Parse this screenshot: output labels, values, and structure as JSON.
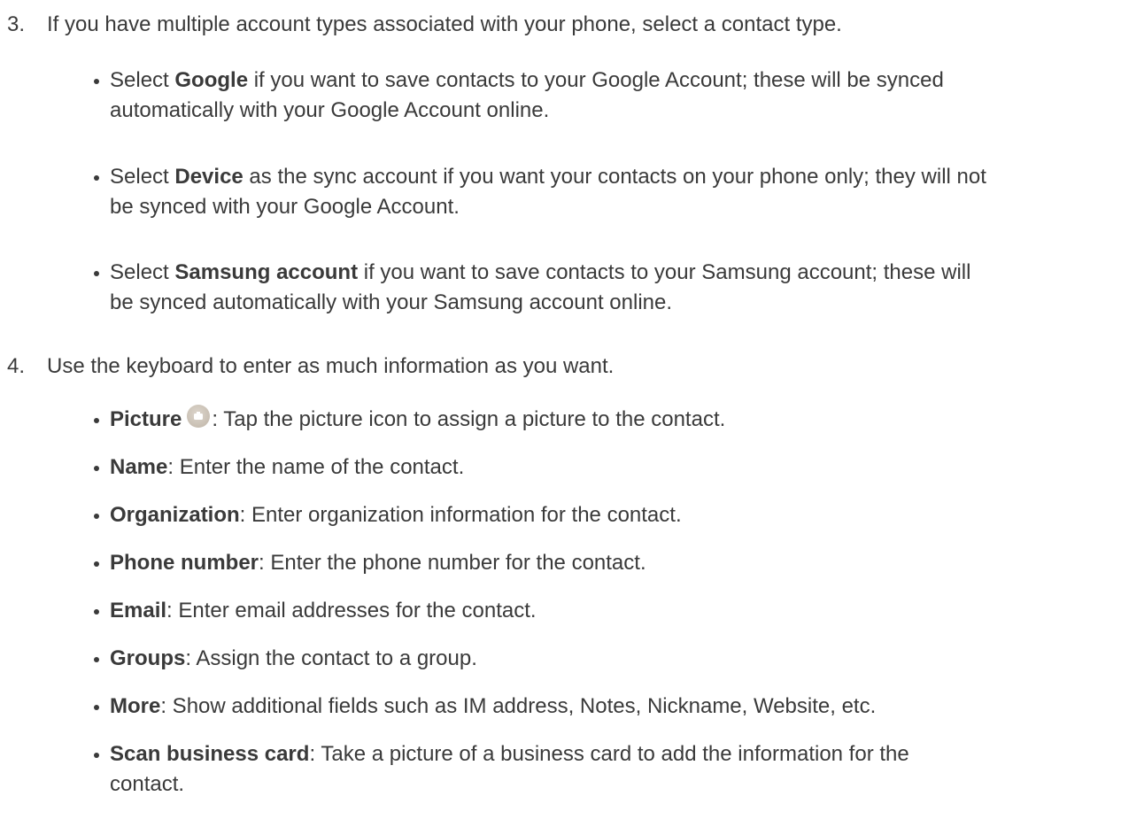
{
  "steps": [
    {
      "number": "3.",
      "text": "If you have multiple account types associated with your phone, select a contact type.",
      "bullets": [
        {
          "prefix": "Select ",
          "bold": "Google",
          "line1": " if you want to save contacts to your Google Account; these will be synced",
          "line2": "automatically with your Google Account online."
        },
        {
          "prefix": "Select ",
          "bold": "Device",
          "line1": " as the sync account if you want your contacts on your phone only; they will not",
          "line2": "be synced with your Google Account."
        },
        {
          "prefix": "Select ",
          "bold": "Samsung account",
          "line1": " if you want to save contacts to your Samsung account; these will",
          "line2": "be synced automatically with your Samsung account online."
        }
      ]
    },
    {
      "number": "4.",
      "text": "Use the keyboard to enter as much information as you want.",
      "fields": [
        {
          "label": "Picture",
          "desc": ": Tap the picture icon to assign a picture to the contact.",
          "icon": "camera-icon"
        },
        {
          "label": "Name",
          "desc": ": Enter the name of the contact."
        },
        {
          "label": "Organization",
          "desc": ": Enter organization information for the contact."
        },
        {
          "label": "Phone number",
          "desc": ": Enter the phone number for the contact."
        },
        {
          "label": "Email",
          "desc": ": Enter email addresses for the contact."
        },
        {
          "label": "Groups",
          "desc": ": Assign the contact to a group."
        },
        {
          "label": "More",
          "desc": ": Show additional fields such as IM address, Notes, Nickname, Website, etc."
        },
        {
          "label": "Scan business card",
          "desc": ": Take a picture of a business card to add the information for the",
          "desc2": "contact."
        }
      ]
    }
  ],
  "colors": {
    "text": "#3a3a3a",
    "background": "#ffffff",
    "icon": "#cbc2b6"
  }
}
